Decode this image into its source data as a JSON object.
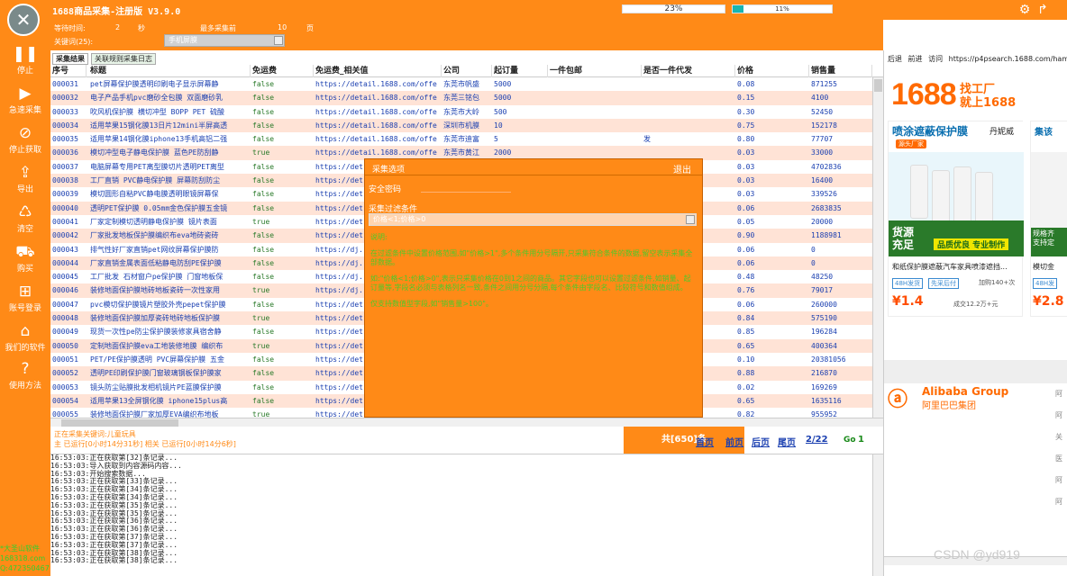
{
  "app": {
    "title": "1688商品采集-注册版 V3.9.0",
    "progress1_label": "23%",
    "progress1_value": 0.23,
    "progress2_label": "11%",
    "progress2_value": 0.11,
    "gear_icon": "gear-icon",
    "pin_icon": "pin-icon"
  },
  "sidebar": {
    "items": [
      {
        "icon": "pause-icon",
        "label": "停止"
      },
      {
        "icon": "play-icon",
        "label": "急速采集"
      },
      {
        "icon": "stop-icon",
        "label": "停止获取"
      },
      {
        "icon": "export-icon",
        "label": "导出"
      },
      {
        "icon": "clear-icon",
        "label": "清空"
      },
      {
        "icon": "cart-icon",
        "label": "购买"
      },
      {
        "icon": "account-icon",
        "label": "账号登录"
      },
      {
        "icon": "home-icon",
        "label": "我们的软件"
      },
      {
        "icon": "help-icon",
        "label": "使用方法"
      }
    ],
    "footer": [
      "*大圣山软件",
      "168318.com",
      "Q:472350467"
    ]
  },
  "settings": {
    "wait_label": "等待时间:",
    "wait_value": "2",
    "wait_unit": "秒",
    "maxpage_label": "最多采集前",
    "maxpage_value": "10",
    "maxpage_unit": "页",
    "keyword_label": "关键词(25):",
    "keyword_value": "手机屏膜"
  },
  "tabs": [
    "采集结果",
    "关联规则采集日志"
  ],
  "table": {
    "headers": [
      "序号",
      "标题",
      "免运费",
      "免运费_相关值",
      "公司",
      "起订量",
      "一件包邮",
      "是否一件代发",
      "价格",
      "销售量"
    ],
    "rows": [
      [
        "000031",
        "pet屏幕保护膜透明印刷电子显示屏幕静",
        "false",
        "https://detail.1688.com/offe",
        "东莞市帆盛",
        "5000",
        "",
        "",
        "0.08",
        "871255"
      ],
      [
        "000032",
        "电子产品手机pvc磨砂全包膜 双面磨砂乳",
        "false",
        "https://detail.1688.com/offe",
        "东莞三铭包",
        "5000",
        "",
        "",
        "0.15",
        "4100"
      ],
      [
        "000033",
        "吹风机保护膜 横切冲型 BOPP PET 硫酸",
        "false",
        "https://detail.1688.com/offe",
        "东莞市大岭",
        "500",
        "",
        "",
        "0.30",
        "52450"
      ],
      [
        "000034",
        "适用苹果15钢化膜13日片12mini半屏高透",
        "false",
        "https://detail.1688.com/offe",
        "深圳市机膜",
        "10",
        "",
        "",
        "0.75",
        "152178"
      ],
      [
        "000035",
        "适用苹果14钢化膜iphone13手机高铝二强",
        "false",
        "https://detail.1688.com/offe",
        "东莞市迪富",
        "5",
        "",
        "发",
        "0.80",
        "77707"
      ],
      [
        "000036",
        "模切冲型电子静电保护膜 蓝色PE防刮静",
        "true",
        "https://detail.1688.com/offe",
        "东莞市黄江",
        "2000",
        "",
        "",
        "0.03",
        "33000"
      ],
      [
        "000037",
        "电脑屏幕专用PET离型膜切片透明PET离型",
        "false",
        "https://det",
        "",
        "",
        "",
        "",
        "0.03",
        "4702836"
      ],
      [
        "000038",
        "工厂直销 PVC静电保护膜 屏幕防刮防尘",
        "false",
        "https://det",
        "",
        "",
        "",
        "",
        "0.03",
        "16400"
      ],
      [
        "000039",
        "模切圆形自粘PVC静电膜透明眼镜屏幕保",
        "false",
        "https://det",
        "",
        "",
        "",
        "",
        "0.03",
        "339526"
      ],
      [
        "000040",
        "透明PET保护膜 0.05mm金色保护膜五金镜",
        "false",
        "https://det",
        "",
        "",
        "",
        "",
        "0.06",
        "2683835"
      ],
      [
        "000041",
        "厂家定制模切透明静电保护膜 镜片表面",
        "true",
        "https://det",
        "",
        "",
        "",
        "",
        "0.05",
        "20000"
      ],
      [
        "000042",
        "厂家批发地板保护膜编织布eva地砖瓷砖",
        "false",
        "https://det",
        "",
        "",
        "",
        "",
        "0.90",
        "1188981"
      ],
      [
        "000043",
        "排气性好厂家直销pet网纹屏幕保护膜防",
        "false",
        "https://dj.",
        "",
        "",
        "",
        "",
        "0.06",
        "0"
      ],
      [
        "000044",
        "厂家直销金属表面低粘静电防刮PE保护膜",
        "false",
        "https://dj.",
        "",
        "",
        "",
        "",
        "0.06",
        "0"
      ],
      [
        "000045",
        "工厂批发 石材窗户pe保护膜 门窗地板保",
        "false",
        "https://dj.",
        "",
        "",
        "",
        "",
        "0.48",
        "48250"
      ],
      [
        "000046",
        "装修地面保护膜地砖地板瓷砖一次性家用",
        "true",
        "https://dj.",
        "",
        "",
        "",
        "",
        "0.76",
        "79017"
      ],
      [
        "000047",
        "pvc模切保护膜镜片塑胶外壳pepet保护膜",
        "false",
        "https://det",
        "",
        "",
        "",
        "",
        "0.06",
        "260000"
      ],
      [
        "000048",
        "装修地面保护膜加厚瓷砖地砖地板保护膜",
        "true",
        "https://det",
        "",
        "",
        "",
        "",
        "0.84",
        "575190"
      ],
      [
        "000049",
        "现货一次性pe防尘保护膜装修家具宿舍静",
        "false",
        "https://det",
        "",
        "",
        "",
        "",
        "0.85",
        "196284"
      ],
      [
        "000050",
        "定制地面保护膜eva工地装修地膜 编织布",
        "true",
        "https://det",
        "",
        "",
        "",
        "",
        "0.65",
        "400364"
      ],
      [
        "000051",
        "PET/PE保护膜透明 PVC屏幕保护膜 五金",
        "false",
        "https://det",
        "",
        "",
        "",
        "",
        "0.10",
        "20381056"
      ],
      [
        "000052",
        "透明PE印刷保护膜门窗玻璃钢板保护膜家",
        "false",
        "https://det",
        "",
        "",
        "",
        "",
        "0.88",
        "216870"
      ],
      [
        "000053",
        "镜头防尘贴膜批发相机镜片PE蓝膜保护膜",
        "false",
        "https://det",
        "",
        "",
        "",
        "",
        "0.02",
        "169269"
      ],
      [
        "000054",
        "适用苹果13全屏钢化膜 iphone15plus高",
        "false",
        "https://det",
        "",
        "",
        "",
        "",
        "0.65",
        "1635116"
      ],
      [
        "000055",
        "装修地面保护膜厂家加厚EVA编织布地板",
        "true",
        "https://det",
        "",
        "",
        "",
        "",
        "0.82",
        "955952"
      ]
    ]
  },
  "status": {
    "line1": "正在采集关键词:儿童玩具",
    "line2": "主 已运行[0小时14分31秒]  相关 已运行[0小时14分6秒]",
    "total": "共[650]条",
    "pager": [
      "首页",
      "前页",
      "后页",
      "尾页"
    ],
    "page": "2/22",
    "go_label": "Go",
    "go_value": "1"
  },
  "log": [
    "16:53:03:正在获取第[32]条记录...",
    "16:53:03:导入获取到内容源码内容...",
    "16:53:03:开始搜索数据...",
    "16:53:03:正在获取第[33]条记录...",
    "16:53:03:正在获取第[34]条记录...",
    "16:53:03:正在获取第[34]条记录...",
    "16:53:03:正在获取第[35]条记录...",
    "16:53:03:正在获取第[35]条记录...",
    "16:53:03:正在获取第[36]条记录...",
    "16:53:03:正在获取第[36]条记录...",
    "16:53:03:正在获取第[37]条记录...",
    "16:53:03:正在获取第[37]条记录...",
    "16:53:03:正在获取第[38]条记录...",
    "16:53:03:正在获取第[38]条记录..."
  ],
  "popup": {
    "title": "采集选项",
    "close": "退出",
    "password_label": "安全密码",
    "filter_label": "采集过滤条件",
    "filter_value": "价格<1;价格>0",
    "help": [
      "说明:",
      "在过滤条件中设置价格范围,如\"价格>1\",多个条件用分号隔开,只采集符合条件的数据,留空表示采集全部数据。",
      "如:\"价格<1;价格>0\",表示只采集价格在0到1之间的商品。其它字段也可以设置过滤条件,如销量、起订量等,字段名必须与表格列名一致,条件之间用分号分隔,每个条件由字段名、比较符号和数值组成。",
      "仅支持数值型字段,如\"销售量>100\"。"
    ]
  },
  "browser": {
    "nav": [
      "后退",
      "前进",
      "访问"
    ],
    "url": "https://p4psearch.1688.com/hamlet",
    "logo_1688": "1688",
    "slogan": [
      "找工厂",
      "就上1688"
    ],
    "ad1": {
      "title": "喷涂遮蔽保护膜",
      "brand": "丹妮威",
      "badge": "源头厂家",
      "source_text": [
        "货源",
        "充足"
      ],
      "tag": "品质优良 专业制作",
      "name": "和纸保护膜遮蔽汽车家具喷漆遮挡...",
      "chips": [
        "48H发货",
        "先采后付"
      ],
      "resale": "加购140+次",
      "price": "¥1.4",
      "sold": "成交12.2万+元"
    },
    "ad2": {
      "title": "集该",
      "source_text": [
        "规格齐",
        "支持定"
      ],
      "name": "模切金",
      "chip": "48H发",
      "price": "¥2.8"
    },
    "alibaba_en": "Alibaba Group",
    "alibaba_cn": "阿里巴巴集团",
    "side_links": [
      "阿",
      "阿",
      "关",
      "医",
      "阿",
      "阿"
    ]
  },
  "watermark": "CSDN @yd919"
}
